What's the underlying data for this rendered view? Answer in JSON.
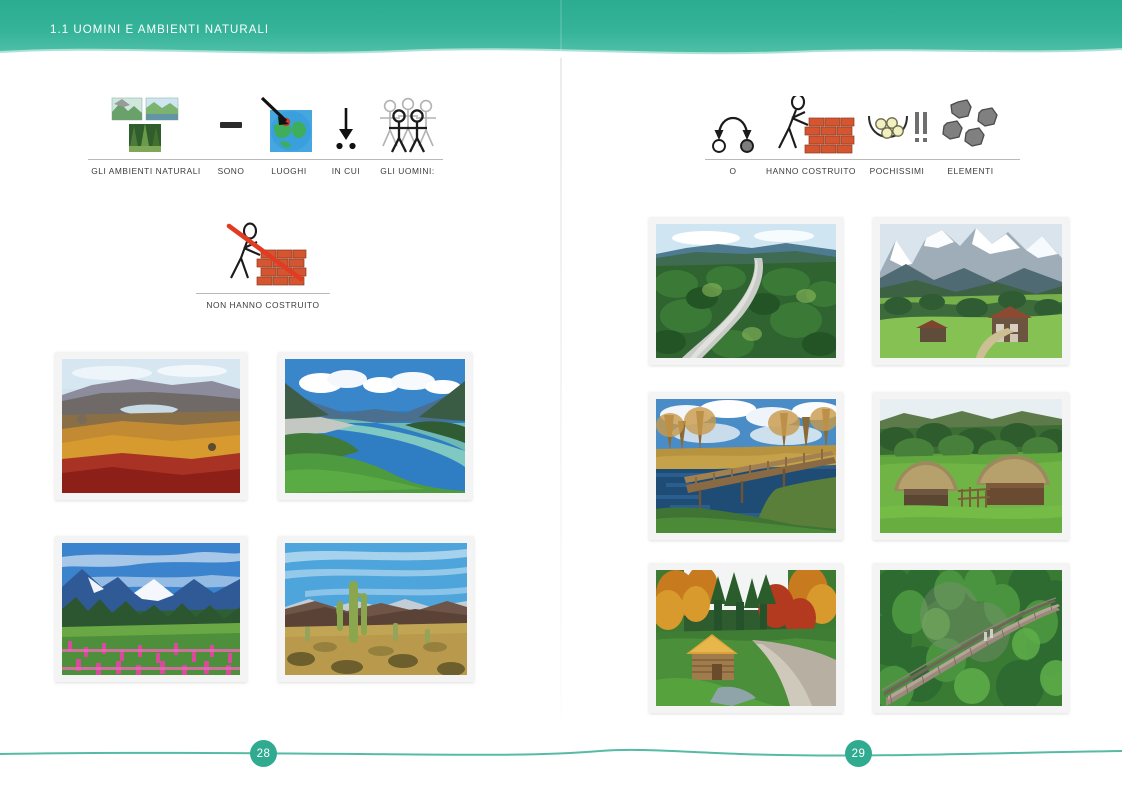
{
  "header": {
    "title": "1.1 UOMINI E AMBIENTI NATURALI",
    "background_color": "#2bab90"
  },
  "accent_color": "#30ab90",
  "left_page": {
    "page_number": "28",
    "sentence_strip": {
      "cells": [
        {
          "label": "GLI AMBIENTI NATURALI",
          "icon": "nature-collage-icon"
        },
        {
          "label": "SONO",
          "icon": "equals-dash-icon"
        },
        {
          "label": "LUOGHI",
          "icon": "globe-pointer-icon"
        },
        {
          "label": "IN CUI",
          "icon": "down-arrow-two-dots-icon"
        },
        {
          "label": "GLI UOMINI:",
          "icon": "group-of-people-icon"
        }
      ]
    },
    "negative_strip": {
      "cells": [
        {
          "label": "NON HANNO COSTRUITO",
          "icon": "builder-wall-crossed-icon"
        }
      ]
    },
    "photos": [
      {
        "caption": "autumn-tundra-lake"
      },
      {
        "caption": "turquoise-river-valley"
      },
      {
        "caption": "pink-wildflower-meadow-mountains"
      },
      {
        "caption": "saguaro-cactus-desert"
      }
    ]
  },
  "right_page": {
    "page_number": "29",
    "sentence_strip": {
      "cells": [
        {
          "label": "O",
          "icon": "arc-two-circles-icon"
        },
        {
          "label": "HANNO COSTRUITO",
          "icon": "builder-wall-icon"
        },
        {
          "label": "POCHISSIMI",
          "icon": "bowl-few-balls-icon"
        },
        {
          "label": "ELEMENTI",
          "icon": "grey-stones-icon"
        }
      ]
    },
    "photos": [
      {
        "caption": "forest-road-aerial"
      },
      {
        "caption": "alpine-chalets-snowy-mountains"
      },
      {
        "caption": "wooden-bridge-autumn-lake"
      },
      {
        "caption": "thatched-huts-green-landscape"
      },
      {
        "caption": "log-cabin-autumn-forest"
      },
      {
        "caption": "suspension-bridge-forest"
      }
    ]
  }
}
